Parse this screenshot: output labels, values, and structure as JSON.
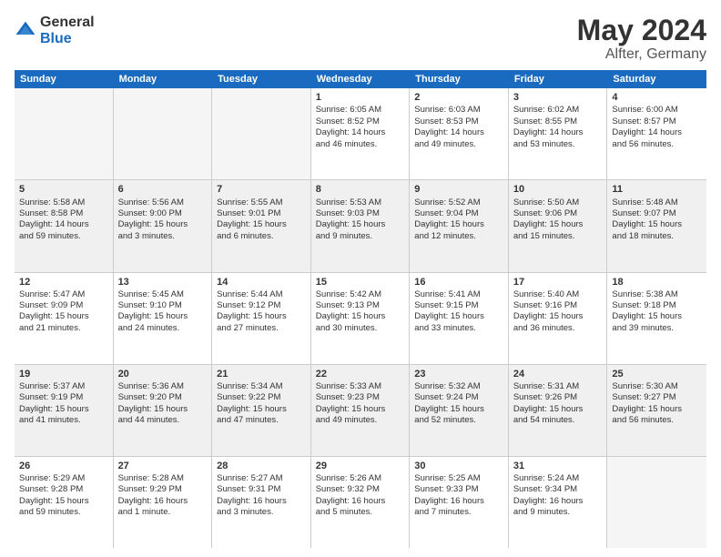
{
  "logo": {
    "general": "General",
    "blue": "Blue"
  },
  "title": "May 2024",
  "location": "Alfter, Germany",
  "days": [
    "Sunday",
    "Monday",
    "Tuesday",
    "Wednesday",
    "Thursday",
    "Friday",
    "Saturday"
  ],
  "weeks": [
    [
      {
        "day": "",
        "info": ""
      },
      {
        "day": "",
        "info": ""
      },
      {
        "day": "",
        "info": ""
      },
      {
        "day": "1",
        "info": "Sunrise: 6:05 AM\nSunset: 8:52 PM\nDaylight: 14 hours\nand 46 minutes."
      },
      {
        "day": "2",
        "info": "Sunrise: 6:03 AM\nSunset: 8:53 PM\nDaylight: 14 hours\nand 49 minutes."
      },
      {
        "day": "3",
        "info": "Sunrise: 6:02 AM\nSunset: 8:55 PM\nDaylight: 14 hours\nand 53 minutes."
      },
      {
        "day": "4",
        "info": "Sunrise: 6:00 AM\nSunset: 8:57 PM\nDaylight: 14 hours\nand 56 minutes."
      }
    ],
    [
      {
        "day": "5",
        "info": "Sunrise: 5:58 AM\nSunset: 8:58 PM\nDaylight: 14 hours\nand 59 minutes."
      },
      {
        "day": "6",
        "info": "Sunrise: 5:56 AM\nSunset: 9:00 PM\nDaylight: 15 hours\nand 3 minutes."
      },
      {
        "day": "7",
        "info": "Sunrise: 5:55 AM\nSunset: 9:01 PM\nDaylight: 15 hours\nand 6 minutes."
      },
      {
        "day": "8",
        "info": "Sunrise: 5:53 AM\nSunset: 9:03 PM\nDaylight: 15 hours\nand 9 minutes."
      },
      {
        "day": "9",
        "info": "Sunrise: 5:52 AM\nSunset: 9:04 PM\nDaylight: 15 hours\nand 12 minutes."
      },
      {
        "day": "10",
        "info": "Sunrise: 5:50 AM\nSunset: 9:06 PM\nDaylight: 15 hours\nand 15 minutes."
      },
      {
        "day": "11",
        "info": "Sunrise: 5:48 AM\nSunset: 9:07 PM\nDaylight: 15 hours\nand 18 minutes."
      }
    ],
    [
      {
        "day": "12",
        "info": "Sunrise: 5:47 AM\nSunset: 9:09 PM\nDaylight: 15 hours\nand 21 minutes."
      },
      {
        "day": "13",
        "info": "Sunrise: 5:45 AM\nSunset: 9:10 PM\nDaylight: 15 hours\nand 24 minutes."
      },
      {
        "day": "14",
        "info": "Sunrise: 5:44 AM\nSunset: 9:12 PM\nDaylight: 15 hours\nand 27 minutes."
      },
      {
        "day": "15",
        "info": "Sunrise: 5:42 AM\nSunset: 9:13 PM\nDaylight: 15 hours\nand 30 minutes."
      },
      {
        "day": "16",
        "info": "Sunrise: 5:41 AM\nSunset: 9:15 PM\nDaylight: 15 hours\nand 33 minutes."
      },
      {
        "day": "17",
        "info": "Sunrise: 5:40 AM\nSunset: 9:16 PM\nDaylight: 15 hours\nand 36 minutes."
      },
      {
        "day": "18",
        "info": "Sunrise: 5:38 AM\nSunset: 9:18 PM\nDaylight: 15 hours\nand 39 minutes."
      }
    ],
    [
      {
        "day": "19",
        "info": "Sunrise: 5:37 AM\nSunset: 9:19 PM\nDaylight: 15 hours\nand 41 minutes."
      },
      {
        "day": "20",
        "info": "Sunrise: 5:36 AM\nSunset: 9:20 PM\nDaylight: 15 hours\nand 44 minutes."
      },
      {
        "day": "21",
        "info": "Sunrise: 5:34 AM\nSunset: 9:22 PM\nDaylight: 15 hours\nand 47 minutes."
      },
      {
        "day": "22",
        "info": "Sunrise: 5:33 AM\nSunset: 9:23 PM\nDaylight: 15 hours\nand 49 minutes."
      },
      {
        "day": "23",
        "info": "Sunrise: 5:32 AM\nSunset: 9:24 PM\nDaylight: 15 hours\nand 52 minutes."
      },
      {
        "day": "24",
        "info": "Sunrise: 5:31 AM\nSunset: 9:26 PM\nDaylight: 15 hours\nand 54 minutes."
      },
      {
        "day": "25",
        "info": "Sunrise: 5:30 AM\nSunset: 9:27 PM\nDaylight: 15 hours\nand 56 minutes."
      }
    ],
    [
      {
        "day": "26",
        "info": "Sunrise: 5:29 AM\nSunset: 9:28 PM\nDaylight: 15 hours\nand 59 minutes."
      },
      {
        "day": "27",
        "info": "Sunrise: 5:28 AM\nSunset: 9:29 PM\nDaylight: 16 hours\nand 1 minute."
      },
      {
        "day": "28",
        "info": "Sunrise: 5:27 AM\nSunset: 9:31 PM\nDaylight: 16 hours\nand 3 minutes."
      },
      {
        "day": "29",
        "info": "Sunrise: 5:26 AM\nSunset: 9:32 PM\nDaylight: 16 hours\nand 5 minutes."
      },
      {
        "day": "30",
        "info": "Sunrise: 5:25 AM\nSunset: 9:33 PM\nDaylight: 16 hours\nand 7 minutes."
      },
      {
        "day": "31",
        "info": "Sunrise: 5:24 AM\nSunset: 9:34 PM\nDaylight: 16 hours\nand 9 minutes."
      },
      {
        "day": "",
        "info": ""
      }
    ]
  ]
}
